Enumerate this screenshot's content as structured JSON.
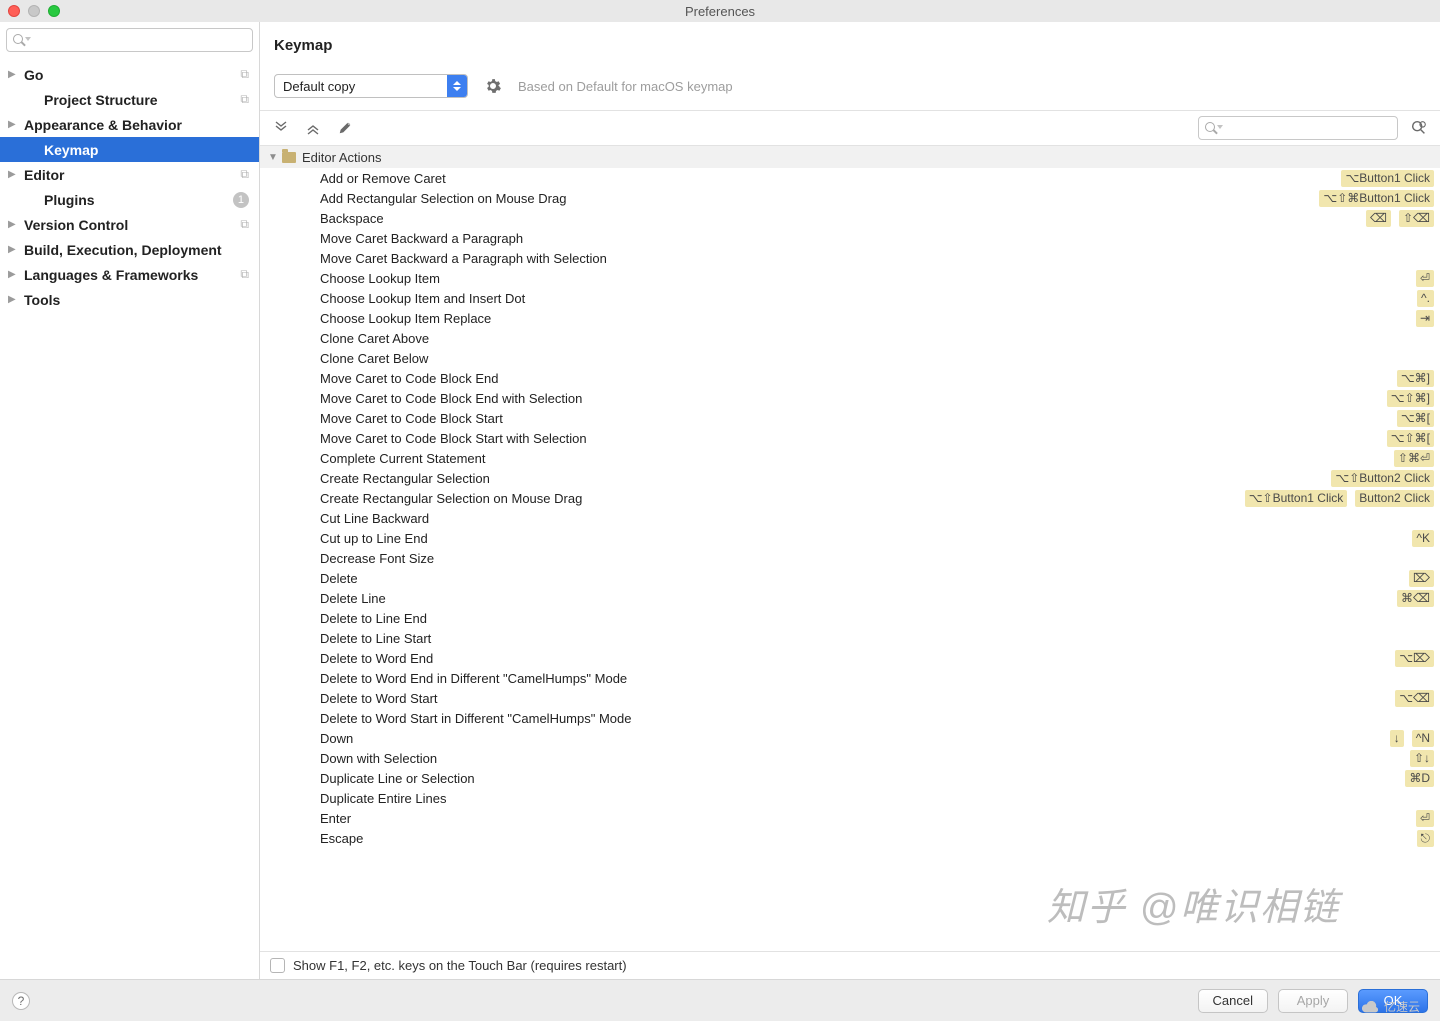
{
  "window": {
    "title": "Preferences"
  },
  "sidebar": {
    "search_placeholder": "",
    "items": [
      {
        "name": "go",
        "label": "Go",
        "expandable": true,
        "badge": "copy"
      },
      {
        "name": "project-structure",
        "label": "Project Structure",
        "expandable": false,
        "badge": "copy",
        "child": true
      },
      {
        "name": "appearance-behavior",
        "label": "Appearance & Behavior",
        "expandable": true
      },
      {
        "name": "keymap",
        "label": "Keymap",
        "expandable": false,
        "selected": true,
        "child": true
      },
      {
        "name": "editor",
        "label": "Editor",
        "expandable": true,
        "badge": "copy"
      },
      {
        "name": "plugins",
        "label": "Plugins",
        "expandable": false,
        "child": true,
        "count": "1"
      },
      {
        "name": "version-control",
        "label": "Version Control",
        "expandable": true,
        "badge": "copy"
      },
      {
        "name": "build-exec-deploy",
        "label": "Build, Execution, Deployment",
        "expandable": true
      },
      {
        "name": "languages-frameworks",
        "label": "Languages & Frameworks",
        "expandable": true,
        "badge": "copy"
      },
      {
        "name": "tools",
        "label": "Tools",
        "expandable": true
      }
    ]
  },
  "main": {
    "title": "Keymap",
    "scheme": "Default copy",
    "based_on": "Based on Default for macOS keymap",
    "search_placeholder": "",
    "group_label": "Editor Actions",
    "touchbar_label": "Show F1, F2, etc. keys on the Touch Bar (requires restart)",
    "actions": [
      {
        "name": "Add or Remove Caret",
        "sc": [
          "⌥Button1 Click"
        ]
      },
      {
        "name": "Add Rectangular Selection on Mouse Drag",
        "sc": [
          "⌥⇧⌘Button1 Click"
        ]
      },
      {
        "name": "Backspace",
        "sc": [
          "⌫",
          "⇧⌫"
        ]
      },
      {
        "name": "Move Caret Backward a Paragraph",
        "sc": []
      },
      {
        "name": "Move Caret Backward a Paragraph with Selection",
        "sc": []
      },
      {
        "name": "Choose Lookup Item",
        "sc": [
          "⏎"
        ]
      },
      {
        "name": "Choose Lookup Item and Insert Dot",
        "sc": [
          "^."
        ]
      },
      {
        "name": "Choose Lookup Item Replace",
        "sc": [
          "⇥"
        ]
      },
      {
        "name": "Clone Caret Above",
        "sc": []
      },
      {
        "name": "Clone Caret Below",
        "sc": []
      },
      {
        "name": "Move Caret to Code Block End",
        "sc": [
          "⌥⌘]"
        ]
      },
      {
        "name": "Move Caret to Code Block End with Selection",
        "sc": [
          "⌥⇧⌘]"
        ]
      },
      {
        "name": "Move Caret to Code Block Start",
        "sc": [
          "⌥⌘["
        ]
      },
      {
        "name": "Move Caret to Code Block Start with Selection",
        "sc": [
          "⌥⇧⌘["
        ]
      },
      {
        "name": "Complete Current Statement",
        "sc": [
          "⇧⌘⏎"
        ]
      },
      {
        "name": "Create Rectangular Selection",
        "sc": [
          "⌥⇧Button2 Click"
        ]
      },
      {
        "name": "Create Rectangular Selection on Mouse Drag",
        "sc": [
          "⌥⇧Button1 Click",
          "Button2 Click"
        ]
      },
      {
        "name": "Cut Line Backward",
        "sc": []
      },
      {
        "name": "Cut up to Line End",
        "sc": [
          "^K"
        ]
      },
      {
        "name": "Decrease Font Size",
        "sc": []
      },
      {
        "name": "Delete",
        "sc": [
          "⌦"
        ]
      },
      {
        "name": "Delete Line",
        "sc": [
          "⌘⌫"
        ]
      },
      {
        "name": "Delete to Line End",
        "sc": []
      },
      {
        "name": "Delete to Line Start",
        "sc": []
      },
      {
        "name": "Delete to Word End",
        "sc": [
          "⌥⌦"
        ]
      },
      {
        "name": "Delete to Word End in Different \"CamelHumps\" Mode",
        "sc": []
      },
      {
        "name": "Delete to Word Start",
        "sc": [
          "⌥⌫"
        ]
      },
      {
        "name": "Delete to Word Start in Different \"CamelHumps\" Mode",
        "sc": []
      },
      {
        "name": "Down",
        "sc": [
          "↓",
          "^N"
        ]
      },
      {
        "name": "Down with Selection",
        "sc": [
          "⇧↓"
        ]
      },
      {
        "name": "Duplicate Line or Selection",
        "sc": [
          "⌘D"
        ]
      },
      {
        "name": "Duplicate Entire Lines",
        "sc": []
      },
      {
        "name": "Enter",
        "sc": [
          "⏎"
        ]
      },
      {
        "name": "Escape",
        "sc": [
          "⎋"
        ]
      }
    ]
  },
  "footer": {
    "cancel": "Cancel",
    "apply": "Apply",
    "ok": "OK"
  },
  "watermark": {
    "big": "知乎 @唯识相链",
    "small": "亿速云"
  }
}
